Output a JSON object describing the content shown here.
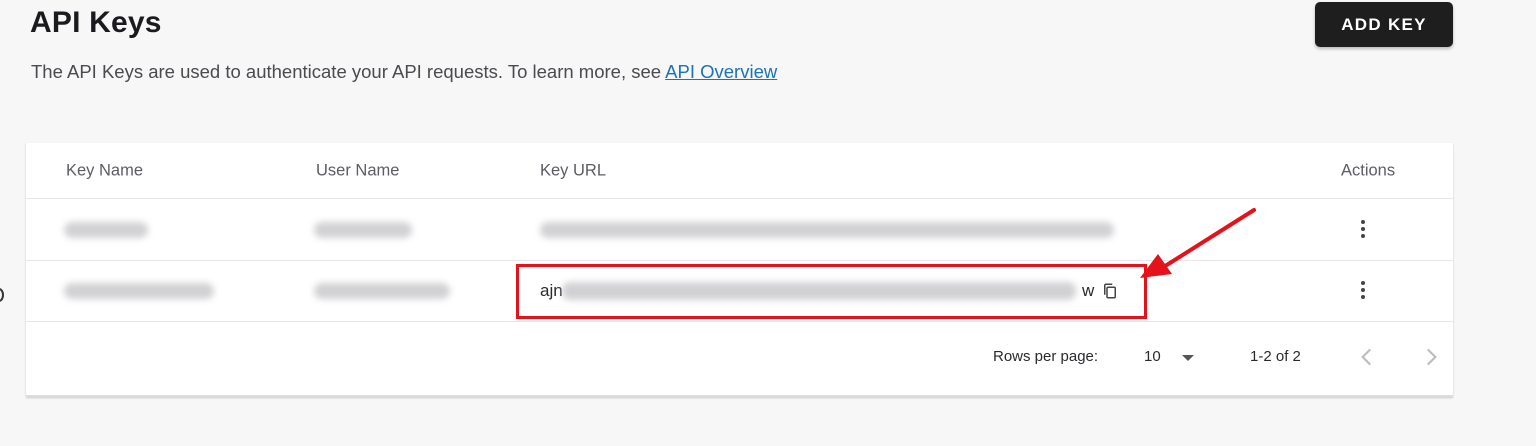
{
  "header": {
    "title": "API Keys",
    "add_key_label": "ADD KEY",
    "subtitle_text": "The API Keys are used to authenticate your API requests. To learn more, see ",
    "overview_link": "API Overview"
  },
  "table": {
    "columns": {
      "key_name": "Key Name",
      "user_name": "User Name",
      "key_url": "Key URL",
      "actions": "Actions"
    },
    "rows": [
      {
        "key_url_start": "",
        "key_url_end": ""
      },
      {
        "key_url_start": "ajn",
        "key_url_end": "w"
      }
    ]
  },
  "pagination": {
    "rows_per_page_label": "Rows per page:",
    "rows_per_page_value": "10",
    "page_info": "1-2 of 2"
  },
  "colors": {
    "highlight": "#e4121b",
    "link": "#1a73b8",
    "button_bg": "#1e1e1e"
  },
  "icons": [
    "kebab-menu-icon",
    "copy-icon",
    "chevron-down-icon",
    "chevron-left-icon",
    "chevron-right-icon",
    "annotation-arrow-icon"
  ]
}
